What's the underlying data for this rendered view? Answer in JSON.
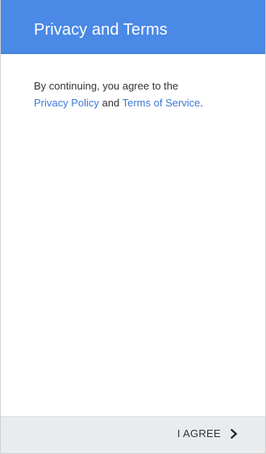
{
  "header": {
    "title": "Privacy and Terms"
  },
  "body": {
    "line1": "By continuing, you agree to the",
    "privacy_link": "Privacy Policy",
    "conjunction": " and ",
    "terms_link": "Terms of Service",
    "period": "."
  },
  "footer": {
    "agree_label": "I AGREE",
    "agree_icon": "chevron-right-icon"
  },
  "colors": {
    "app_bar": "#4a89e6",
    "link": "#3f78d6",
    "footer_bg": "#e9ecee"
  }
}
